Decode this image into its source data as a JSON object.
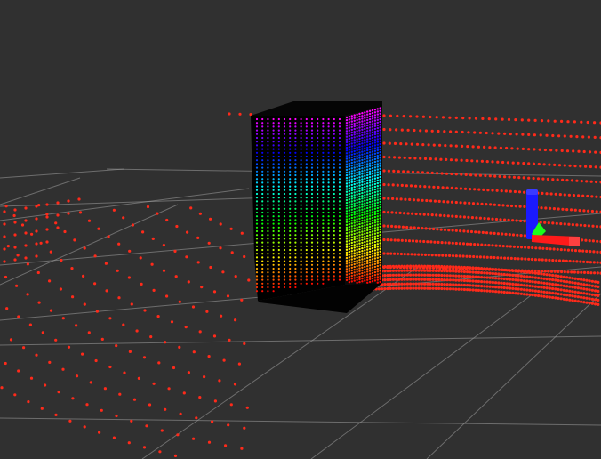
{
  "colors": {
    "background": "#303030",
    "grid": "#a0a0a0",
    "lidar_points": "#ff2a1a",
    "object_faces": "#000000",
    "axis_x": "#ff1a1a",
    "axis_y": "#1aff1a",
    "axis_z": "#1a1aff"
  },
  "height_colormap": [
    "#ff0000",
    "#ffff00",
    "#00ff00",
    "#00ffff",
    "#0000ff",
    "#ff00ff"
  ],
  "icons": {
    "axes_marker": "axes-icon"
  }
}
